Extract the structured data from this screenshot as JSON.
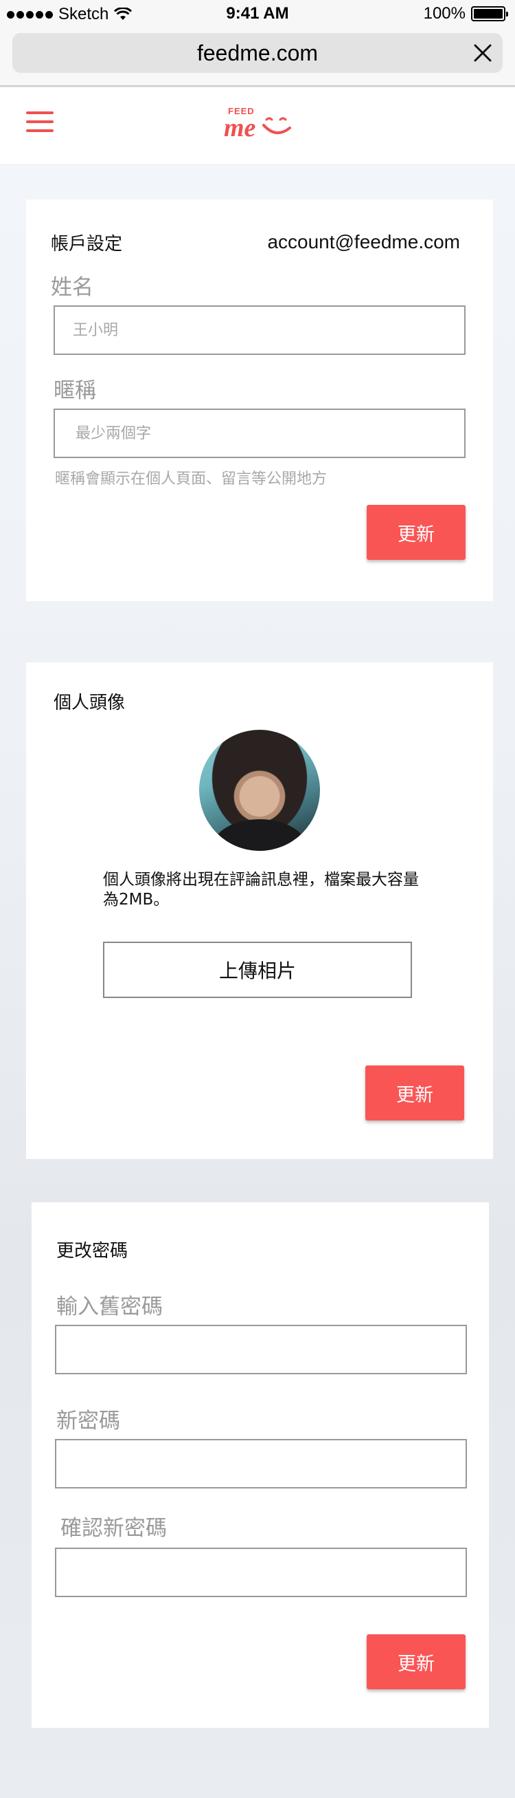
{
  "status_bar": {
    "carrier": "Sketch",
    "time": "9:41 AM",
    "battery": "100%"
  },
  "browser": {
    "url": "feedme.com"
  },
  "header": {
    "logo_top": "FEED",
    "logo_bottom": "me",
    "brand_color": "#f05050"
  },
  "account": {
    "title": "帳戶設定",
    "email": "account@feedme.com",
    "name_label": "姓名",
    "name_placeholder": "王小明",
    "nickname_label": "暱稱",
    "nickname_placeholder": "最少兩個字",
    "nickname_hint": "暱稱會顯示在個人頁面、留言等公開地方",
    "update_label": "更新"
  },
  "avatar": {
    "title": "個人頭像",
    "description": "個人頭像將出現在評論訊息裡，檔案最大容量為2MB。",
    "upload_label": "上傳相片",
    "update_label": "更新"
  },
  "password": {
    "title": "更改密碼",
    "old_label": "輸入舊密碼",
    "new_label": "新密碼",
    "confirm_label": "確認新密碼",
    "update_label": "更新"
  },
  "colors": {
    "accent": "#fa5555"
  }
}
